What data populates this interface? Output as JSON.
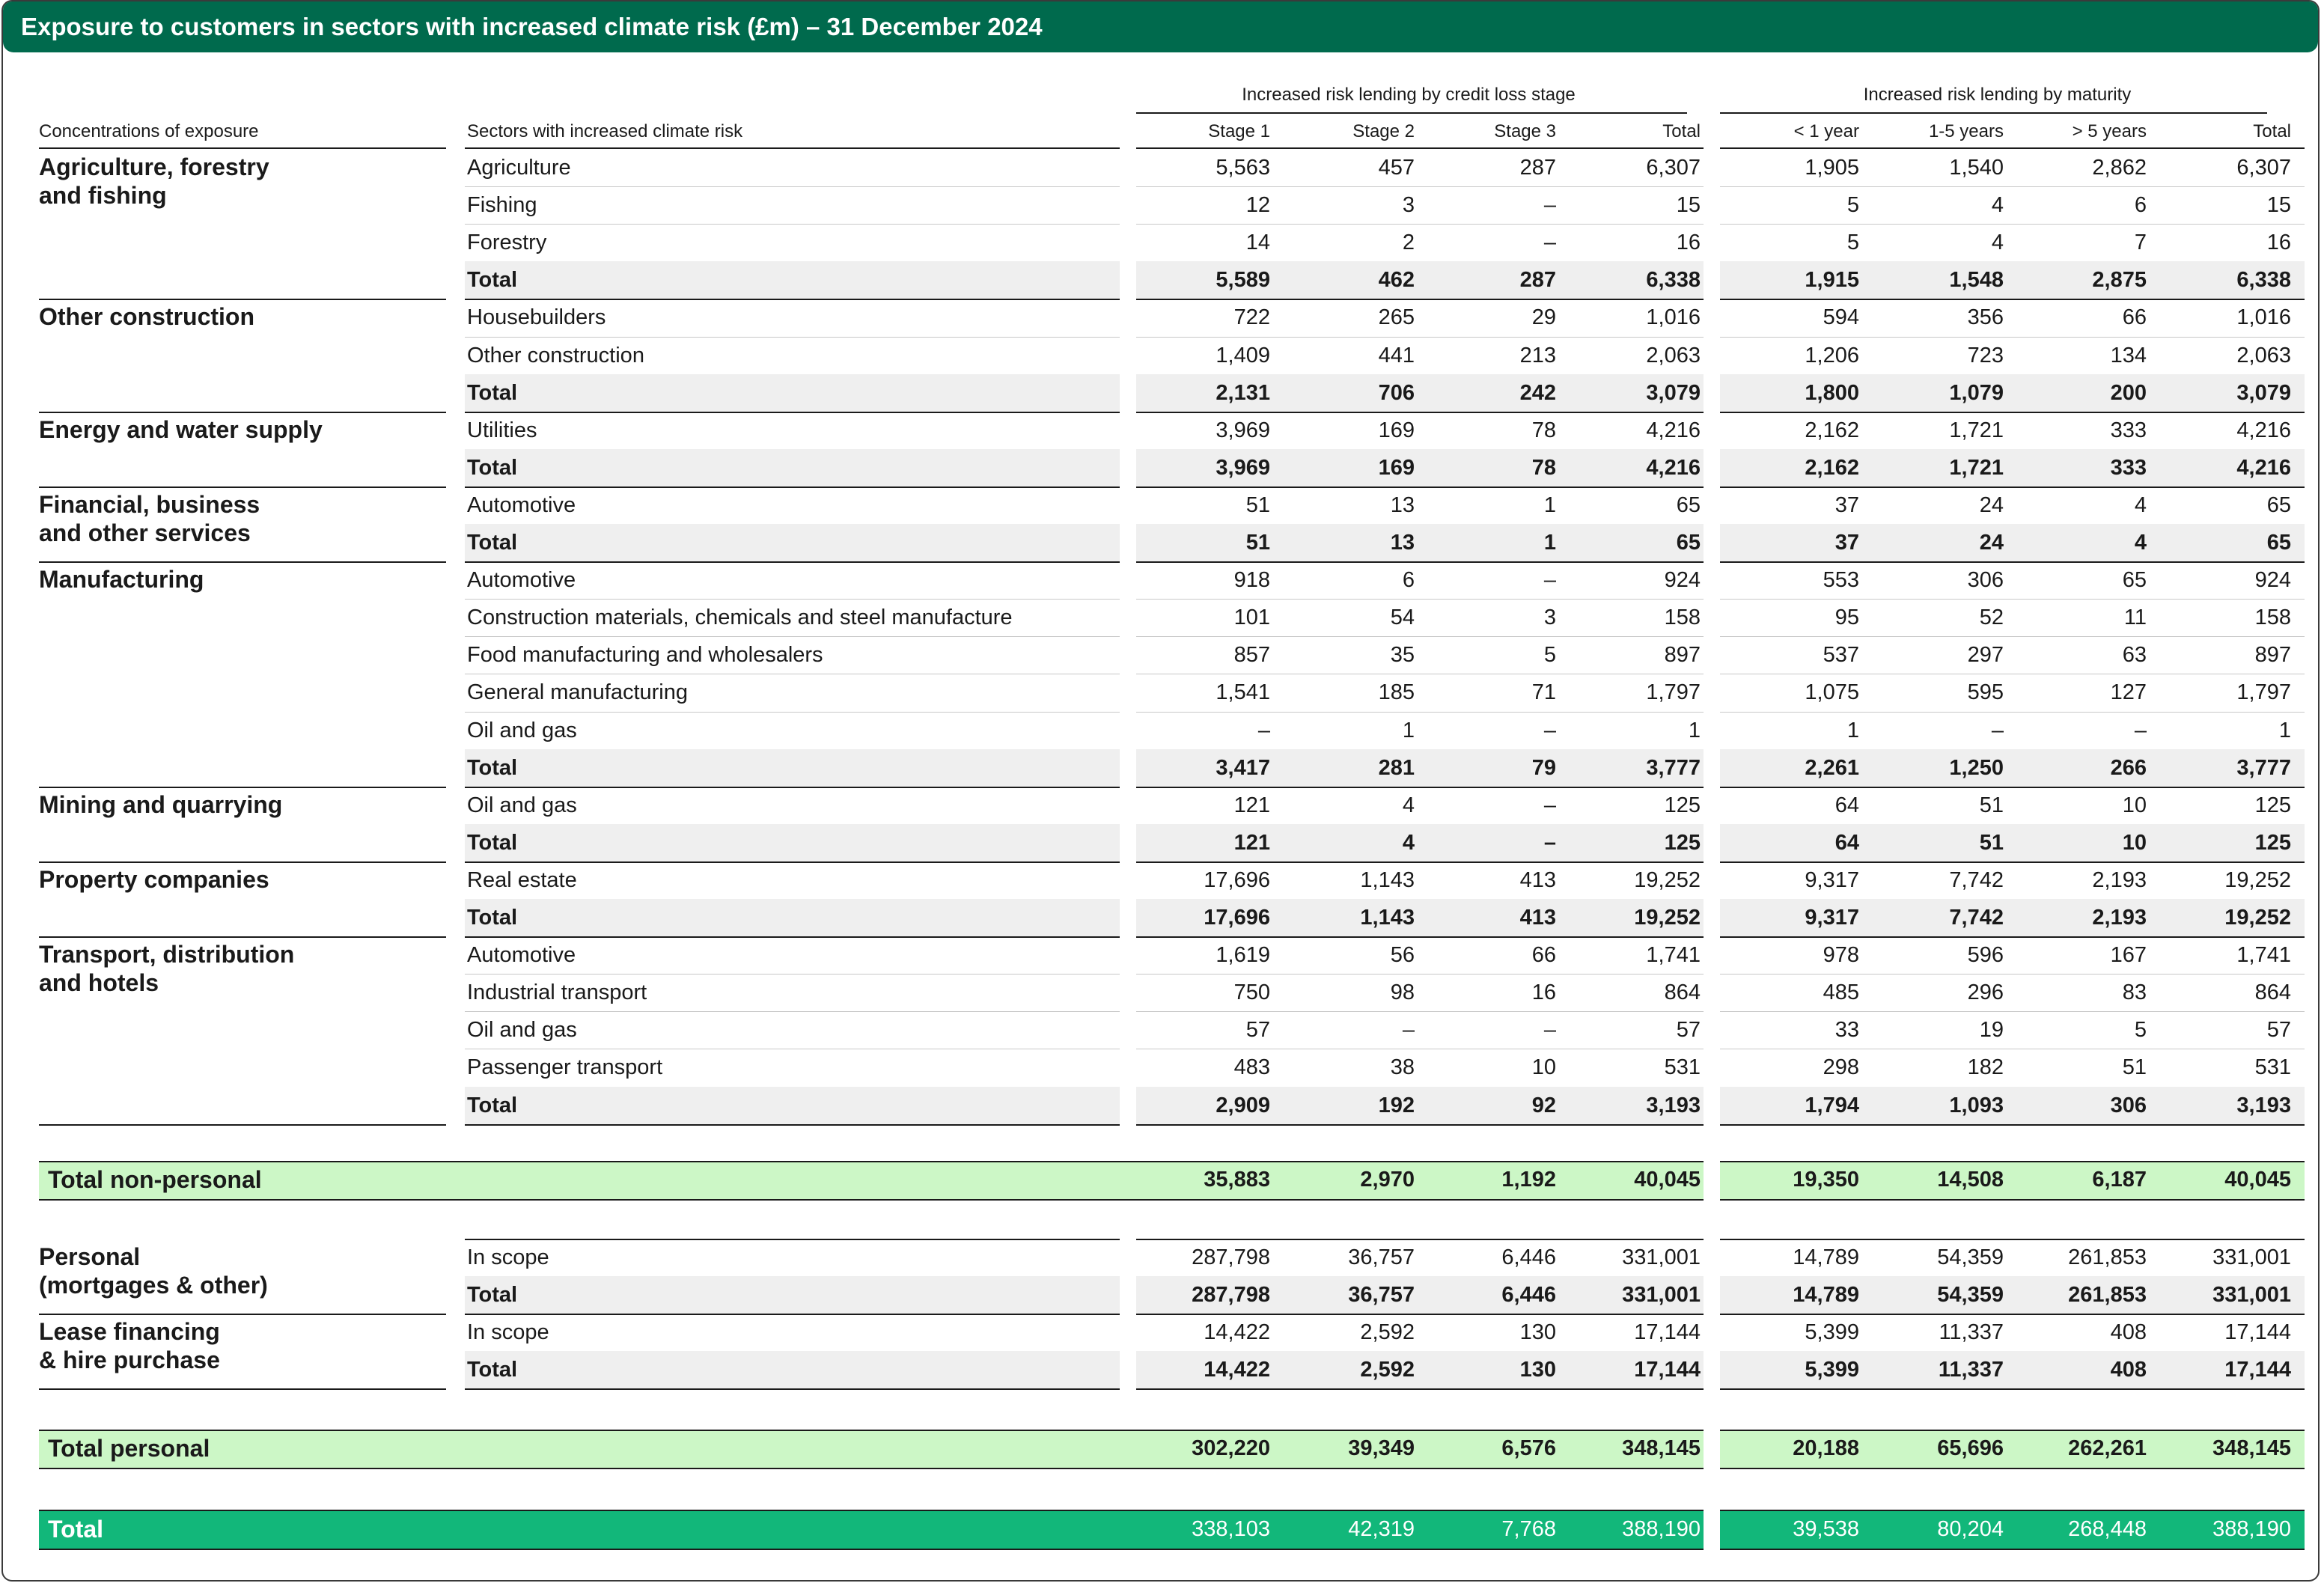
{
  "title": "Exposure to customers in sectors with increased climate risk (£m) – 31 December 2024",
  "headers": {
    "concentrations": "Concentrations of exposure",
    "sectors": "Sectors with increased climate risk",
    "stage_group": "Increased risk lending by credit loss stage",
    "maturity_group": "Increased risk lending by maturity",
    "columns": [
      "Stage 1",
      "Stage 2",
      "Stage 3",
      "Total",
      "< 1 year",
      "1-5 years",
      "> 5 years",
      "Total"
    ]
  },
  "non_personal_groups": [
    {
      "name": "Agriculture, forestry\nand fishing",
      "rows": [
        {
          "sector": "Agriculture",
          "values": [
            "5,563",
            "457",
            "287",
            "6,307",
            "1,905",
            "1,540",
            "2,862",
            "6,307"
          ]
        },
        {
          "sector": "Fishing",
          "values": [
            "12",
            "3",
            "–",
            "15",
            "5",
            "4",
            "6",
            "15"
          ]
        },
        {
          "sector": "Forestry",
          "values": [
            "14",
            "2",
            "–",
            "16",
            "5",
            "4",
            "7",
            "16"
          ]
        },
        {
          "sector": "Total",
          "total": true,
          "values": [
            "5,589",
            "462",
            "287",
            "6,338",
            "1,915",
            "1,548",
            "2,875",
            "6,338"
          ]
        }
      ]
    },
    {
      "name": "Other construction",
      "rows": [
        {
          "sector": "Housebuilders",
          "values": [
            "722",
            "265",
            "29",
            "1,016",
            "594",
            "356",
            "66",
            "1,016"
          ]
        },
        {
          "sector": "Other construction",
          "values": [
            "1,409",
            "441",
            "213",
            "2,063",
            "1,206",
            "723",
            "134",
            "2,063"
          ]
        },
        {
          "sector": "Total",
          "total": true,
          "values": [
            "2,131",
            "706",
            "242",
            "3,079",
            "1,800",
            "1,079",
            "200",
            "3,079"
          ]
        }
      ]
    },
    {
      "name": "Energy and water supply",
      "rows": [
        {
          "sector": "Utilities",
          "values": [
            "3,969",
            "169",
            "78",
            "4,216",
            "2,162",
            "1,721",
            "333",
            "4,216"
          ]
        },
        {
          "sector": "Total",
          "total": true,
          "values": [
            "3,969",
            "169",
            "78",
            "4,216",
            "2,162",
            "1,721",
            "333",
            "4,216"
          ]
        }
      ]
    },
    {
      "name": "Financial, business\nand other services",
      "rows": [
        {
          "sector": "Automotive",
          "values": [
            "51",
            "13",
            "1",
            "65",
            "37",
            "24",
            "4",
            "65"
          ]
        },
        {
          "sector": "Total",
          "total": true,
          "values": [
            "51",
            "13",
            "1",
            "65",
            "37",
            "24",
            "4",
            "65"
          ]
        }
      ]
    },
    {
      "name": "Manufacturing",
      "rows": [
        {
          "sector": "Automotive",
          "values": [
            "918",
            "6",
            "–",
            "924",
            "553",
            "306",
            "65",
            "924"
          ]
        },
        {
          "sector": "Construction materials, chemicals and steel manufacture",
          "values": [
            "101",
            "54",
            "3",
            "158",
            "95",
            "52",
            "11",
            "158"
          ]
        },
        {
          "sector": "Food manufacturing and wholesalers",
          "values": [
            "857",
            "35",
            "5",
            "897",
            "537",
            "297",
            "63",
            "897"
          ]
        },
        {
          "sector": "General manufacturing",
          "values": [
            "1,541",
            "185",
            "71",
            "1,797",
            "1,075",
            "595",
            "127",
            "1,797"
          ]
        },
        {
          "sector": "Oil and gas",
          "values": [
            "–",
            "1",
            "–",
            "1",
            "1",
            "–",
            "–",
            "1"
          ]
        },
        {
          "sector": "Total",
          "total": true,
          "values": [
            "3,417",
            "281",
            "79",
            "3,777",
            "2,261",
            "1,250",
            "266",
            "3,777"
          ]
        }
      ]
    },
    {
      "name": "Mining and quarrying",
      "rows": [
        {
          "sector": "Oil and gas",
          "values": [
            "121",
            "4",
            "–",
            "125",
            "64",
            "51",
            "10",
            "125"
          ]
        },
        {
          "sector": "Total",
          "total": true,
          "values": [
            "121",
            "4",
            "–",
            "125",
            "64",
            "51",
            "10",
            "125"
          ]
        }
      ]
    },
    {
      "name": "Property companies",
      "rows": [
        {
          "sector": "Real estate",
          "values": [
            "17,696",
            "1,143",
            "413",
            "19,252",
            "9,317",
            "7,742",
            "2,193",
            "19,252"
          ]
        },
        {
          "sector": "Total",
          "total": true,
          "values": [
            "17,696",
            "1,143",
            "413",
            "19,252",
            "9,317",
            "7,742",
            "2,193",
            "19,252"
          ]
        }
      ]
    },
    {
      "name": "Transport, distribution\nand hotels",
      "rows": [
        {
          "sector": "Automotive",
          "values": [
            "1,619",
            "56",
            "66",
            "1,741",
            "978",
            "596",
            "167",
            "1,741"
          ]
        },
        {
          "sector": "Industrial transport",
          "values": [
            "750",
            "98",
            "16",
            "864",
            "485",
            "296",
            "83",
            "864"
          ]
        },
        {
          "sector": "Oil and gas",
          "values": [
            "57",
            "–",
            "–",
            "57",
            "33",
            "19",
            "5",
            "57"
          ]
        },
        {
          "sector": "Passenger transport",
          "values": [
            "483",
            "38",
            "10",
            "531",
            "298",
            "182",
            "51",
            "531"
          ]
        },
        {
          "sector": "Total",
          "total": true,
          "values": [
            "2,909",
            "192",
            "92",
            "3,193",
            "1,794",
            "1,093",
            "306",
            "3,193"
          ]
        }
      ]
    }
  ],
  "total_non_personal": {
    "label": "Total non-personal",
    "values": [
      "35,883",
      "2,970",
      "1,192",
      "40,045",
      "19,350",
      "14,508",
      "6,187",
      "40,045"
    ]
  },
  "personal_groups": [
    {
      "name": "Personal\n(mortgages & other)",
      "rows": [
        {
          "sector": "In scope",
          "values": [
            "287,798",
            "36,757",
            "6,446",
            "331,001",
            "14,789",
            "54,359",
            "261,853",
            "331,001"
          ]
        },
        {
          "sector": "Total",
          "total": true,
          "values": [
            "287,798",
            "36,757",
            "6,446",
            "331,001",
            "14,789",
            "54,359",
            "261,853",
            "331,001"
          ]
        }
      ]
    },
    {
      "name": "Lease financing\n& hire purchase",
      "rows": [
        {
          "sector": "In scope",
          "values": [
            "14,422",
            "2,592",
            "130",
            "17,144",
            "5,399",
            "11,337",
            "408",
            "17,144"
          ]
        },
        {
          "sector": "Total",
          "total": true,
          "values": [
            "14,422",
            "2,592",
            "130",
            "17,144",
            "5,399",
            "11,337",
            "408",
            "17,144"
          ]
        }
      ]
    }
  ],
  "total_personal": {
    "label": "Total personal",
    "values": [
      "302,220",
      "39,349",
      "6,576",
      "348,145",
      "20,188",
      "65,696",
      "262,261",
      "348,145"
    ]
  },
  "grand_total": {
    "label": "Total",
    "values": [
      "338,103",
      "42,319",
      "7,768",
      "388,190",
      "39,538",
      "80,204",
      "268,448",
      "388,190"
    ]
  },
  "colors": {
    "title_bg": "#006a4d",
    "total_row_bg": "#efefef",
    "subtotal_band_bg": "#ccf7c6",
    "grand_total_bg": "#12b77a"
  }
}
